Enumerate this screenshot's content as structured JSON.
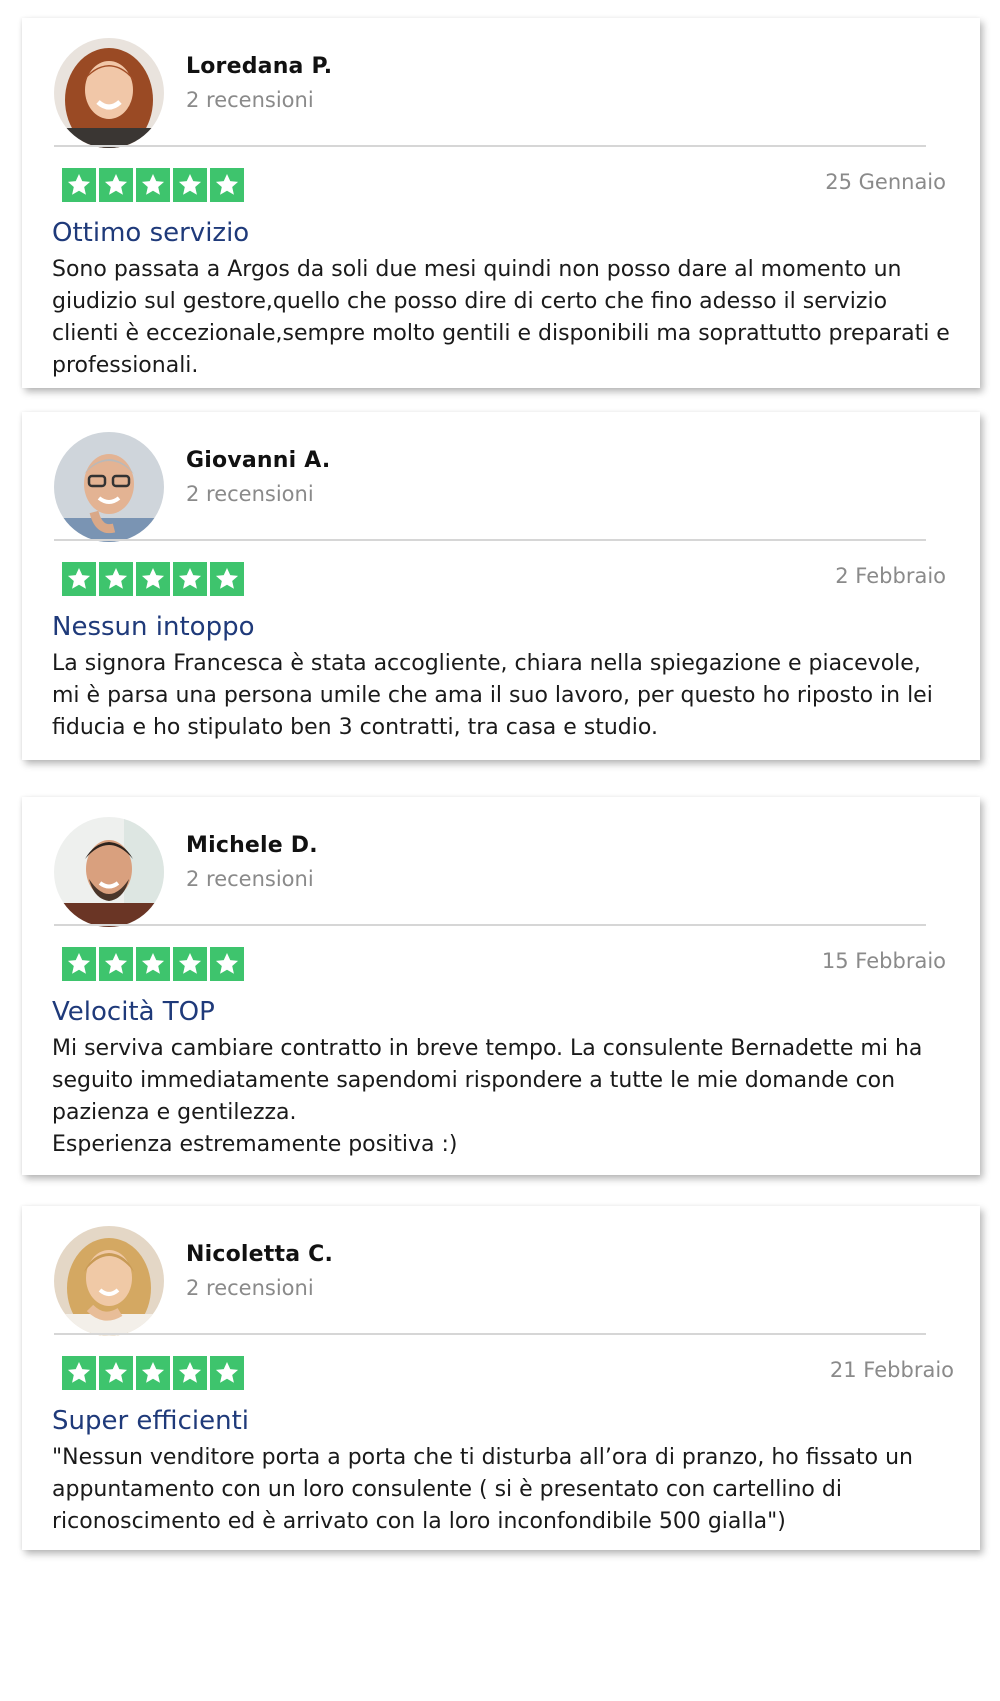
{
  "colors": {
    "star_bg": "#3ec46d",
    "title": "#1f3a7a",
    "muted": "#8a8a8a"
  },
  "reviews": [
    {
      "name": "Loredana P.",
      "count": "2 recensioni",
      "stars": 5,
      "date": "25 Gennaio",
      "title": "Ottimo servizio",
      "body": "Sono passata a Argos da soli due mesi quindi non posso dare al momento un giudizio sul gestore,quello che posso dire di certo che fino adesso il servizio clienti è eccezionale,sempre molto gentili e disponibili ma soprattutto preparati e professionali."
    },
    {
      "name": "Giovanni A.",
      "count": "2 recensioni",
      "stars": 5,
      "date": "2 Febbraio",
      "title": "Nessun intoppo",
      "body": "La signora Francesca è stata accogliente, chiara nella spiegazione e piacevole, mi è parsa una persona umile che ama il suo lavoro, per questo ho riposto in lei fiducia e ho stipulato ben 3 contratti, tra casa e studio."
    },
    {
      "name": "Michele D.",
      "count": "2 recensioni",
      "stars": 5,
      "date": "15 Febbraio",
      "title": "Velocità TOP",
      "body": "Mi serviva cambiare contratto in breve tempo. La consulente Bernadette mi ha seguito immediatamente sapendomi rispondere a tutte le mie domande con pazienza e gentilezza.\nEsperienza estremamente positiva :)"
    },
    {
      "name": "Nicoletta C.",
      "count": "2 recensioni",
      "stars": 5,
      "date": "21 Febbraio",
      "title": "Super efficienti",
      "body": "\"Nessun venditore porta a porta che ti disturba all’ora di pranzo, ho fissato un appuntamento con un loro consulente ( si è presentato con cartellino di riconoscimento ed è arrivato con la loro inconfondibile 500 gialla\")"
    }
  ]
}
